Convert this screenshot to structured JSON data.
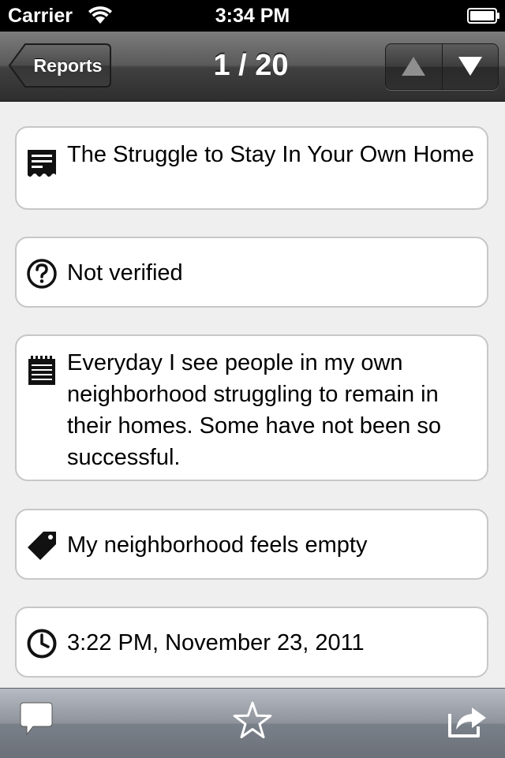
{
  "status_bar": {
    "carrier": "Carrier",
    "time": "3:34 PM"
  },
  "nav": {
    "back_label": "Reports",
    "position": "1 / 20"
  },
  "report": {
    "title": "The Struggle to Stay In Your Own Home",
    "verification": "Not verified",
    "description": "Everyday I see people in my own neighborhood struggling to remain in their homes. Some have not been so successful.",
    "category": "My neighborhood feels empty",
    "date": "3:22 PM, November 23, 2011"
  },
  "icons": {
    "title": "receipt-icon",
    "verification": "question-circle-icon",
    "description": "notepad-icon",
    "category": "tag-icon",
    "date": "clock-icon",
    "comment": "speech-bubble-icon",
    "favorite": "star-icon",
    "share": "share-icon"
  },
  "colors": {
    "status_bar": "#000000",
    "nav_bar": "#4a4a4a",
    "background": "#efefef",
    "card_border": "#c7c7c7",
    "tab_bar": "#8e939b"
  }
}
